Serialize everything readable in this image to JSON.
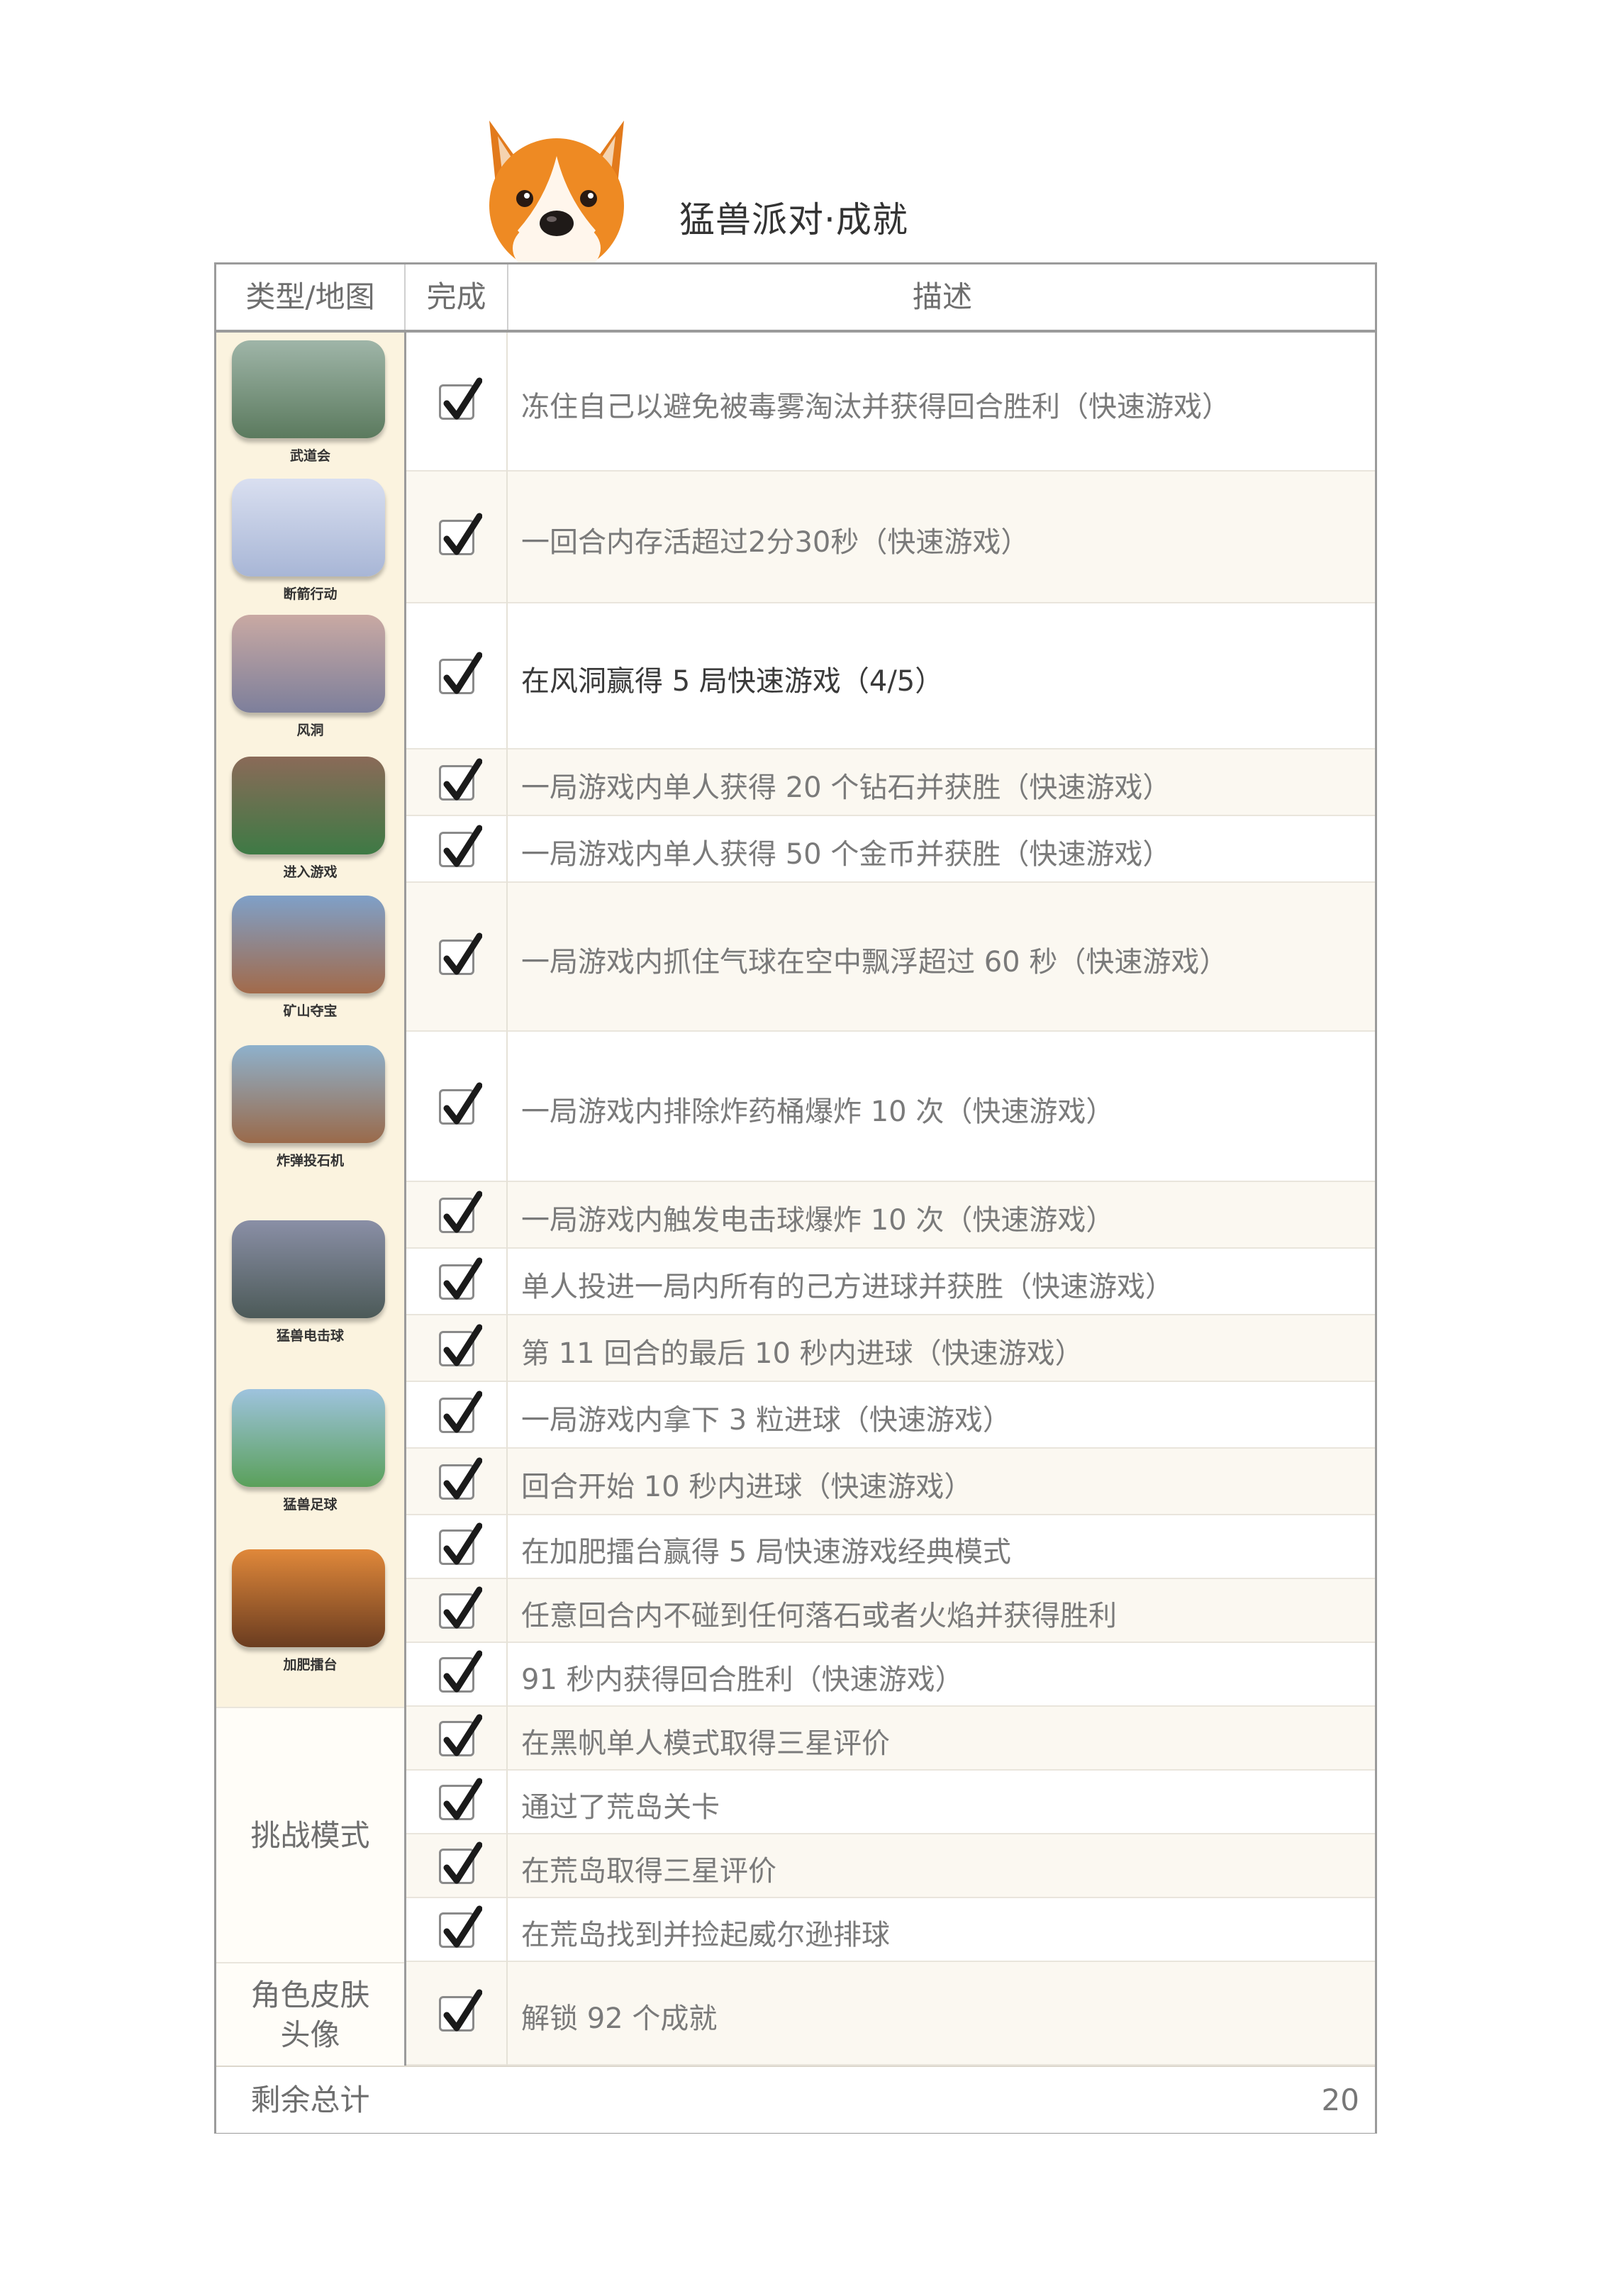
{
  "title": "猛兽派对·成就",
  "headers": {
    "type_map": "类型/地图",
    "done": "完成",
    "desc": "描述"
  },
  "maps": [
    {
      "name": "武道会",
      "color_top": "#9fb5a8",
      "color_bottom": "#5b7a5e"
    },
    {
      "name": "断箭行动",
      "color_top": "#d9dff0",
      "color_bottom": "#a8b6d6"
    },
    {
      "name": "风洞",
      "color_top": "#c9a9a3",
      "color_bottom": "#7d7f9b"
    },
    {
      "name": "进入游戏",
      "color_top": "#8a6a58",
      "color_bottom": "#3e7a45"
    },
    {
      "name": "矿山夺宝",
      "color_top": "#7fa0c8",
      "color_bottom": "#a26a4a"
    },
    {
      "name": "炸弹投石机",
      "color_top": "#8eb1cc",
      "color_bottom": "#9a6a4a"
    },
    {
      "name": "猛兽电击球",
      "color_top": "#8a8fa6",
      "color_bottom": "#4c5a58"
    },
    {
      "name": "猛兽足球",
      "color_top": "#9ec3de",
      "color_bottom": "#5aa05a"
    },
    {
      "name": "加肥擂台",
      "color_top": "#e0883a",
      "color_bottom": "#6a3c20"
    }
  ],
  "categories": {
    "challenge": "挑战模式",
    "skin_line1": "角色皮肤",
    "skin_line2": "头像"
  },
  "achievements": [
    "冻住自己以避免被毒雾淘汰并获得回合胜利（快速游戏）",
    "一回合内存活超过2分30秒（快速游戏）",
    "在风洞赢得 5 局快速游戏（4/5）",
    "一局游戏内单人获得 20 个钻石并获胜（快速游戏）",
    "一局游戏内单人获得 50 个金币并获胜（快速游戏）",
    "一局游戏内抓住气球在空中飘浮超过 60 秒（快速游戏）",
    "一局游戏内排除炸药桶爆炸 10 次（快速游戏）",
    "一局游戏内触发电击球爆炸 10 次（快速游戏）",
    "单人投进一局内所有的己方进球并获胜（快速游戏）",
    "第 11 回合的最后 10 秒内进球（快速游戏）",
    "一局游戏内拿下 3 粒进球（快速游戏）",
    "回合开始 10 秒内进球（快速游戏）",
    "在加肥擂台赢得 5 局快速游戏经典模式",
    "任意回合内不碰到任何落石或者火焰并获得胜利",
    "91 秒内获得回合胜利（快速游戏）",
    "在黑帆单人模式取得三星评价",
    "通过了荒岛关卡",
    "在荒岛取得三星评价",
    "在荒岛找到并捡起威尔逊排球",
    "解锁 92 个成就"
  ],
  "total_label": "剩余总计",
  "total_value": "20"
}
